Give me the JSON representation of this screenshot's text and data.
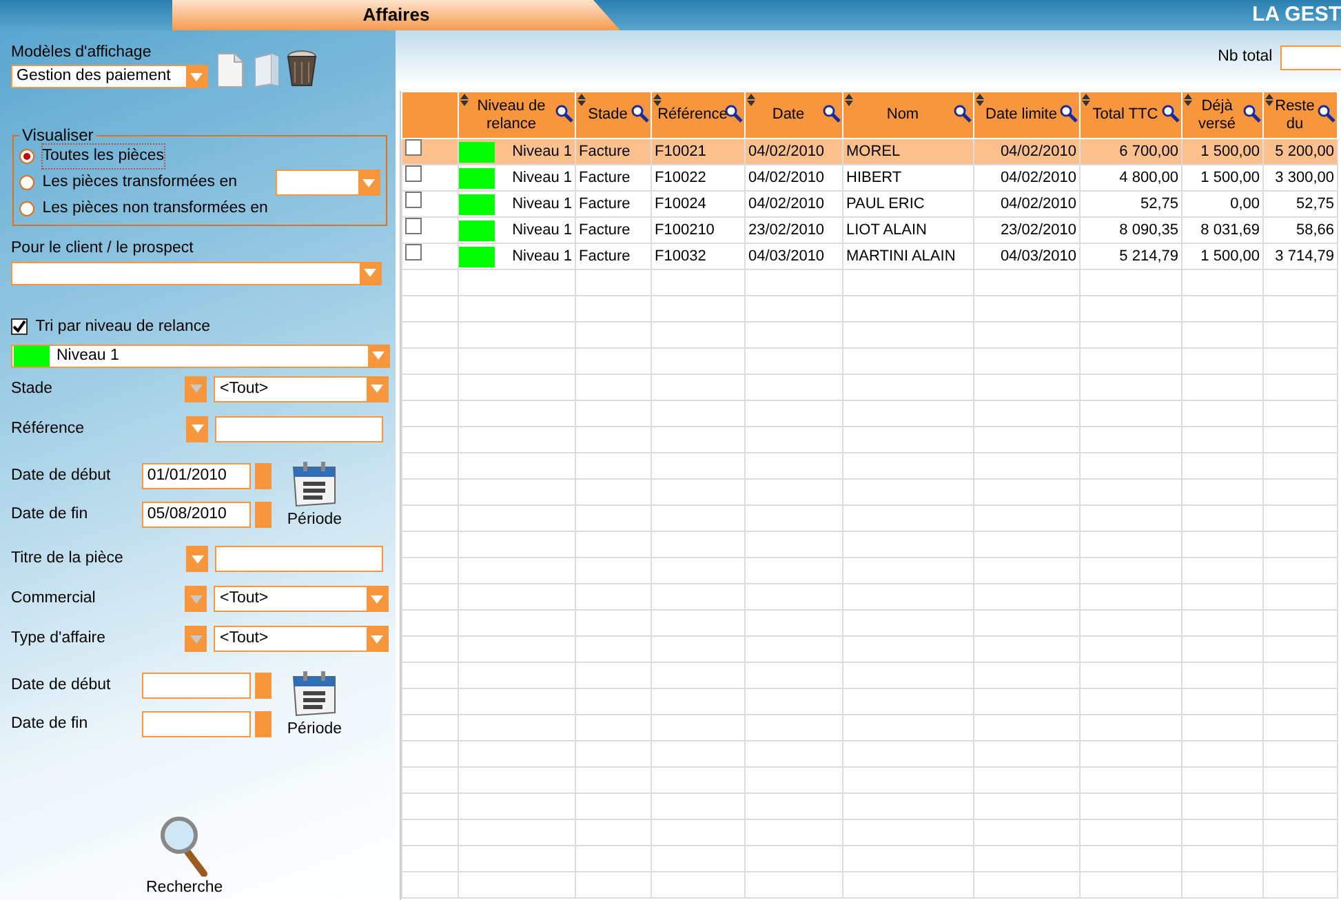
{
  "header": {
    "tab": "Affaires",
    "app_title": "LA GEST"
  },
  "models": {
    "label": "Modèles d'affichage",
    "value": "Gestion des paiement"
  },
  "visualiser": {
    "legend": "Visualiser",
    "options": [
      {
        "label": "Toutes les pièces",
        "selected": true,
        "kind": "plain"
      },
      {
        "label": "Les pièces transformées en",
        "selected": false,
        "kind": "with-select"
      },
      {
        "label": "Les pièces non transformées en",
        "selected": false,
        "kind": "plain"
      }
    ]
  },
  "client": {
    "label": "Pour le client / le prospect"
  },
  "sort": {
    "label": "Tri par niveau de relance",
    "checked": true,
    "level": "Niveau 1",
    "color": "#00ff00"
  },
  "criteria": [
    {
      "kind": "combo",
      "label": "Stade",
      "value": "<Tout>"
    },
    {
      "kind": "text",
      "label": "Référence"
    },
    {
      "kind": "period",
      "start_label": "Date de début",
      "start_value": "01/01/2010",
      "end_label": "Date de fin",
      "end_value": "05/08/2010",
      "button": "Période"
    },
    {
      "kind": "text",
      "label": "Titre de la pièce"
    },
    {
      "kind": "combo",
      "label": "Commercial",
      "value": "<Tout>"
    },
    {
      "kind": "combo",
      "label": "Type d'affaire",
      "value": "<Tout>"
    },
    {
      "kind": "period",
      "start_label": "Date de début",
      "end_label": "Date de fin",
      "button": "Période"
    }
  ],
  "search_button": "Recherche",
  "nb_total": {
    "label": "Nb total"
  },
  "table": {
    "columns": [
      "Niveau de relance",
      "Stade",
      "Référence",
      "Date",
      "Nom",
      "Date limite",
      "Total TTC",
      "Déjà versé",
      "Reste du"
    ],
    "rows": [
      {
        "selected": true,
        "checked": false,
        "color": "#00ff00",
        "cells": [
          "Niveau 1",
          "Facture",
          "F10021",
          "04/02/2010",
          "MOREL",
          "04/02/2010",
          "6 700,00",
          "1 500,00",
          "5 200,00"
        ]
      },
      {
        "selected": false,
        "checked": false,
        "color": "#00ff00",
        "cells": [
          "Niveau 1",
          "Facture",
          "F10022",
          "04/02/2010",
          "HIBERT",
          "04/02/2010",
          "4 800,00",
          "1 500,00",
          "3 300,00"
        ]
      },
      {
        "selected": false,
        "checked": false,
        "color": "#00ff00",
        "cells": [
          "Niveau 1",
          "Facture",
          "F10024",
          "04/02/2010",
          "PAUL ERIC",
          "04/02/2010",
          "52,75",
          "0,00",
          "52,75"
        ]
      },
      {
        "selected": false,
        "checked": false,
        "color": "#00ff00",
        "cells": [
          "Niveau 1",
          "Facture",
          "F100210",
          "23/02/2010",
          "LIOT ALAIN",
          "23/02/2010",
          "8 090,35",
          "8 031,69",
          "58,66"
        ]
      },
      {
        "selected": false,
        "checked": false,
        "color": "#00ff00",
        "cells": [
          "Niveau 1",
          "Facture",
          "F10032",
          "04/03/2010",
          "MARTINI ALAIN",
          "04/03/2010",
          "5 214,79",
          "1 500,00",
          "3 714,79"
        ]
      }
    ]
  }
}
